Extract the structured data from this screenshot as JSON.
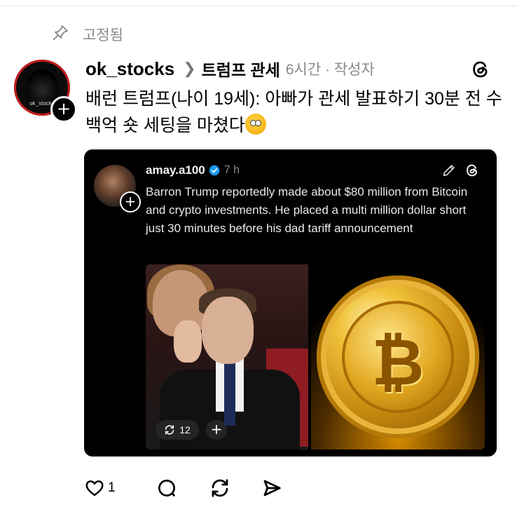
{
  "pinned": {
    "label": "고정됨",
    "icon": "pin-icon"
  },
  "post": {
    "username": "ok_stocks",
    "avatar_tag": "ok_stocks",
    "topic": "트럼프 관세",
    "meta": "6시간 · 작성자",
    "text": "배런 트럼프(나이 19세): 아빠가 관세 발표하기 30분 전 수백억 숏 세팅을 마쳤다",
    "emoji": "face-with-open-eyes-and-hand-over-mouth"
  },
  "quoted": {
    "username": "amay.a100",
    "time": "7 h",
    "text": "Barron Trump reportedly made about $80 million from Bitcoin and crypto investments. He placed a multi million dollar short just 30 minutes before his dad tariff announcement",
    "repost_count": "12",
    "plus": "+"
  },
  "actions": {
    "like_count": "1"
  },
  "colors": {
    "card_bg": "#000000",
    "verified": "#1d9bf0",
    "muted": "#8a8a8a",
    "avatar_ring": "#c41d1d"
  }
}
